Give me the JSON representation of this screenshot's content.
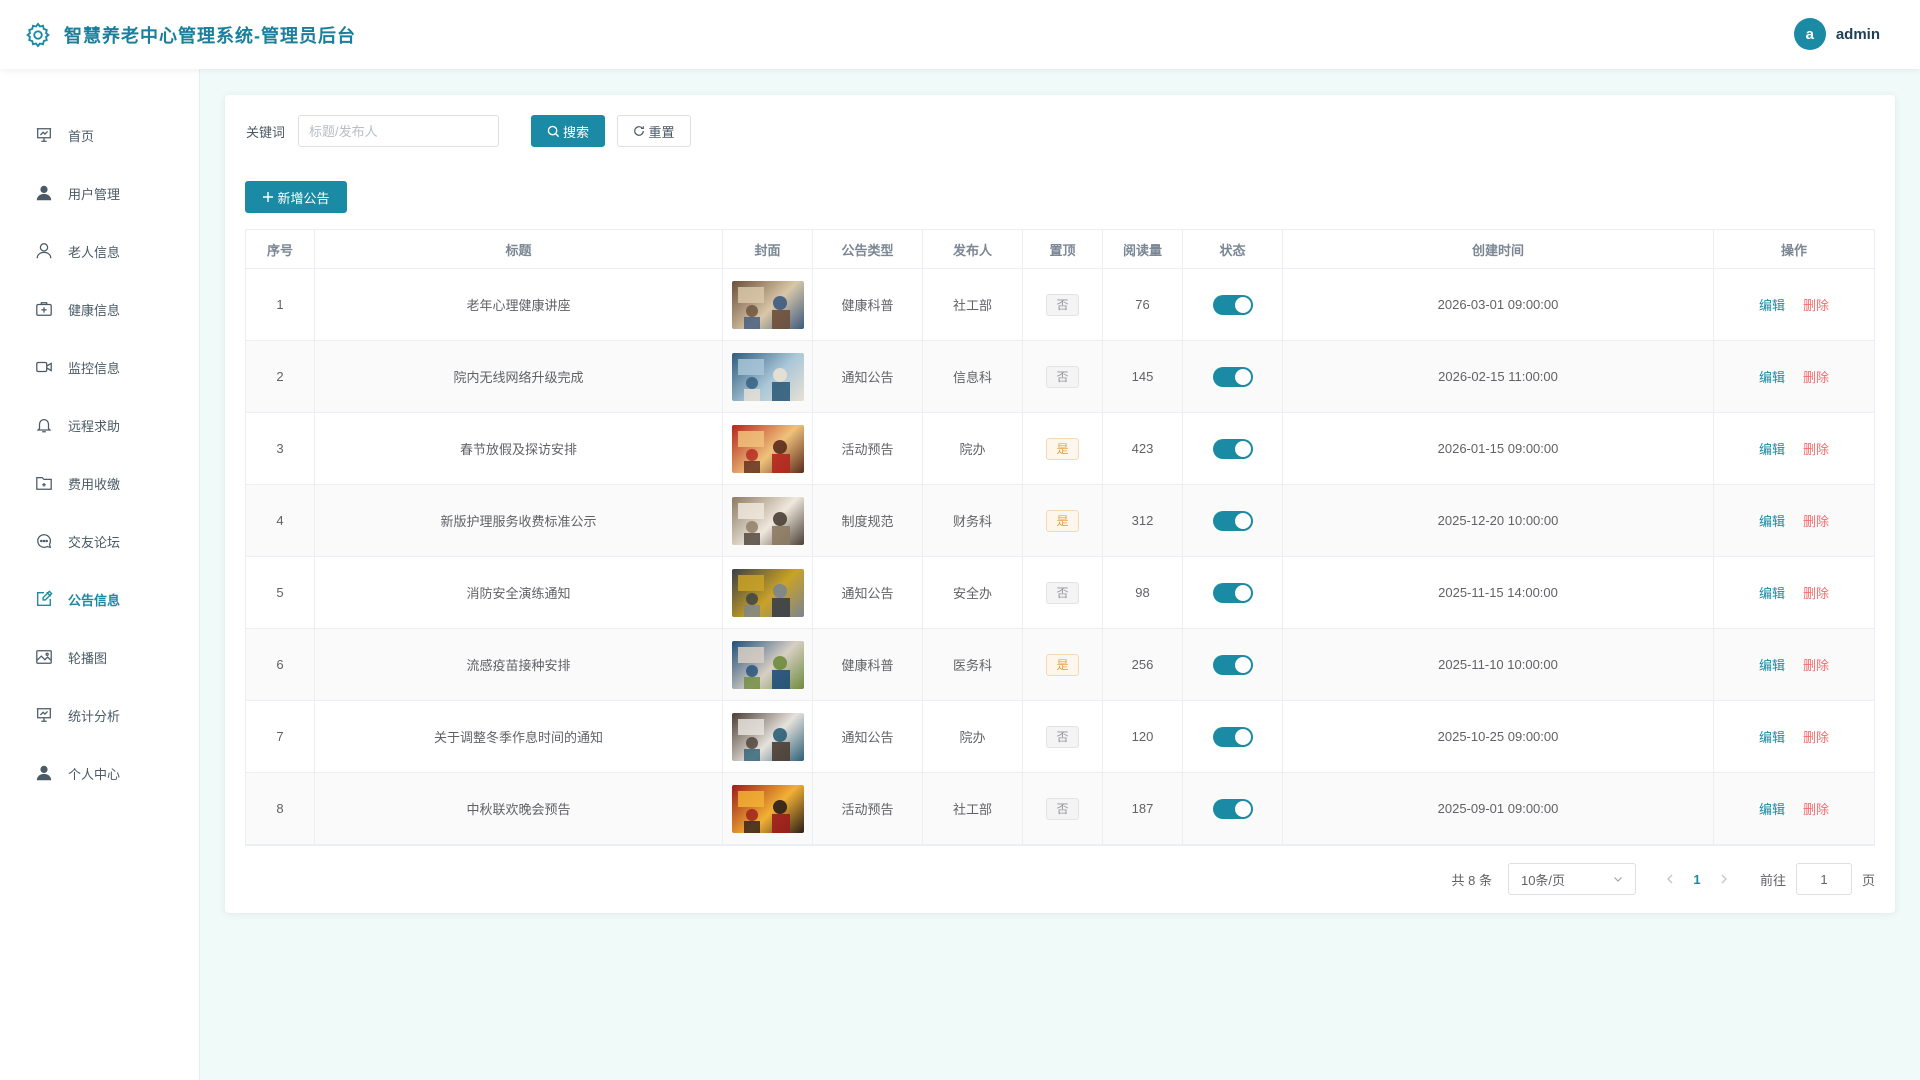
{
  "header": {
    "title": "智慧养老中心管理系统-管理员后台",
    "avatar_letter": "a",
    "username": "admin"
  },
  "sidebar": {
    "items": [
      {
        "label": "首页",
        "icon": "home-chart-icon"
      },
      {
        "label": "用户管理",
        "icon": "user-filled-icon"
      },
      {
        "label": "老人信息",
        "icon": "user-outline-icon"
      },
      {
        "label": "健康信息",
        "icon": "medical-box-icon"
      },
      {
        "label": "监控信息",
        "icon": "video-camera-icon"
      },
      {
        "label": "远程求助",
        "icon": "bell-icon"
      },
      {
        "label": "费用收缴",
        "icon": "folder-icon"
      },
      {
        "label": "交友论坛",
        "icon": "chat-dots-icon"
      },
      {
        "label": "公告信息",
        "icon": "notice-edit-icon",
        "active": true
      },
      {
        "label": "轮播图",
        "icon": "picture-icon"
      },
      {
        "label": "统计分析",
        "icon": "data-board-icon"
      },
      {
        "label": "个人中心",
        "icon": "user-filled-icon"
      }
    ]
  },
  "filter": {
    "keyword_label": "关键词",
    "keyword_placeholder": "标题/发布人",
    "search_label": "搜索",
    "reset_label": "重置",
    "add_label": "新增公告"
  },
  "table": {
    "columns": [
      "序号",
      "标题",
      "封面",
      "公告类型",
      "发布人",
      "置顶",
      "阅读量",
      "状态",
      "创建时间",
      "操作"
    ],
    "edit_label": "编辑",
    "delete_label": "删除",
    "rows": [
      {
        "no": "1",
        "title": "老年心理健康讲座",
        "type": "健康科普",
        "publisher": "社工部",
        "pinned": "否",
        "reads": "76",
        "created": "2026-03-01 09:00:00"
      },
      {
        "no": "2",
        "title": "院内无线网络升级完成",
        "type": "通知公告",
        "publisher": "信息科",
        "pinned": "否",
        "reads": "145",
        "created": "2026-02-15 11:00:00"
      },
      {
        "no": "3",
        "title": "春节放假及探访安排",
        "type": "活动预告",
        "publisher": "院办",
        "pinned": "是",
        "reads": "423",
        "created": "2026-01-15 09:00:00"
      },
      {
        "no": "4",
        "title": "新版护理服务收费标准公示",
        "type": "制度规范",
        "publisher": "财务科",
        "pinned": "是",
        "reads": "312",
        "created": "2025-12-20 10:00:00"
      },
      {
        "no": "5",
        "title": "消防安全演练通知",
        "type": "通知公告",
        "publisher": "安全办",
        "pinned": "否",
        "reads": "98",
        "created": "2025-11-15 14:00:00"
      },
      {
        "no": "6",
        "title": "流感疫苗接种安排",
        "type": "健康科普",
        "publisher": "医务科",
        "pinned": "是",
        "reads": "256",
        "created": "2025-11-10 10:00:00"
      },
      {
        "no": "7",
        "title": "关于调整冬季作息时间的通知",
        "type": "通知公告",
        "publisher": "院办",
        "pinned": "否",
        "reads": "120",
        "created": "2025-10-25 09:00:00"
      },
      {
        "no": "8",
        "title": "中秋联欢晚会预告",
        "type": "活动预告",
        "publisher": "社工部",
        "pinned": "否",
        "reads": "187",
        "created": "2025-09-01 09:00:00"
      }
    ]
  },
  "pagination": {
    "total_text": "共 8 条",
    "page_size": "10条/页",
    "current_page": "1",
    "goto_label": "前往",
    "goto_value": "1",
    "page_unit": "页"
  },
  "colors": {
    "primary": "#1a8aa5",
    "danger": "#f56c6c",
    "warning": "#e6a23c"
  }
}
